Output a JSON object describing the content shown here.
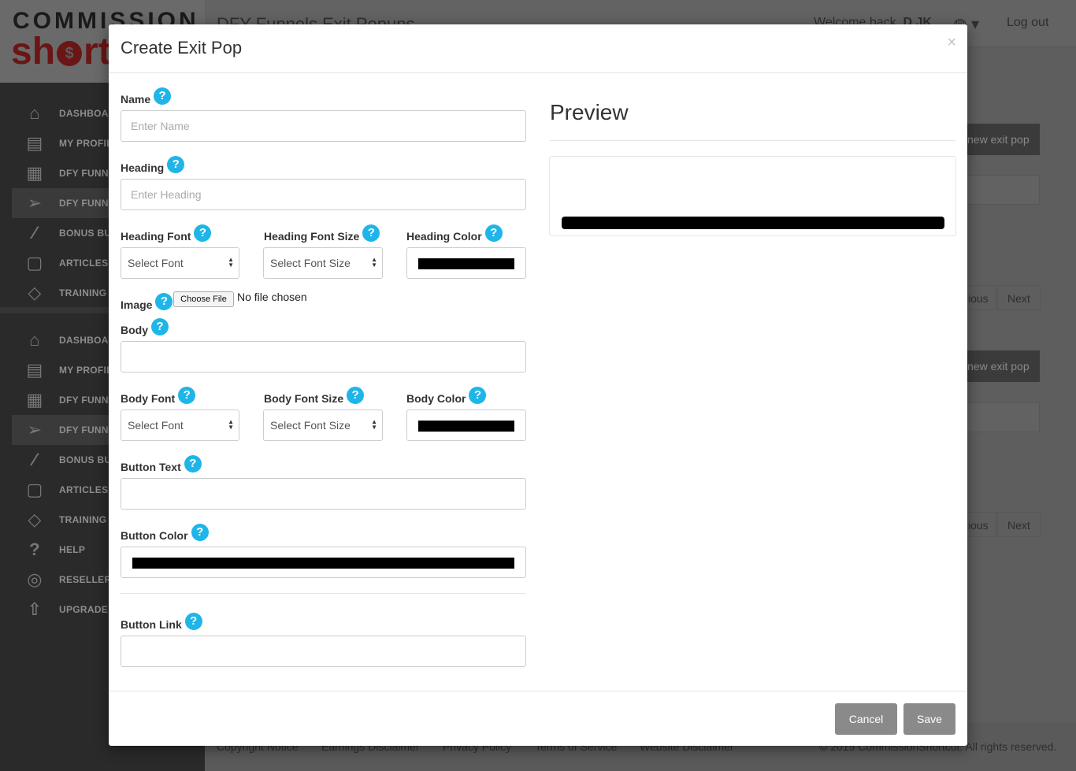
{
  "app": {
    "logo_top": "COMMISSION",
    "logo_bottom_left": "sh",
    "logo_coin": "$",
    "logo_bottom_right": "rt",
    "page_title": "DFY Funnels Exit Popups",
    "welcome_prefix": "Welcome back,",
    "welcome_user": "D JK",
    "logout": "Log out",
    "new_exit_pop_1": "new exit pop",
    "new_exit_pop_2": "new exit pop",
    "previous_1": "ious",
    "next_1": "Next",
    "previous_2": "ious",
    "next_2": "Next"
  },
  "sidebar": {
    "group1": [
      {
        "label": "DASHBOAR",
        "icon": "home-icon"
      },
      {
        "label": "MY PROFILI",
        "icon": "profile-icon"
      },
      {
        "label": "DFY FUNNE",
        "icon": "gift-icon"
      },
      {
        "label": "DFY FUNNE",
        "icon": "send-icon"
      },
      {
        "label": "BONUS BUI",
        "icon": "magic-wand-icon"
      },
      {
        "label": "ARTICLES",
        "icon": "clipboard-icon"
      },
      {
        "label": "TRAINING",
        "icon": "graduation-cap-icon"
      }
    ],
    "group2": [
      {
        "label": "DASHBOAR",
        "icon": "home-icon"
      },
      {
        "label": "MY PROFILI",
        "icon": "profile-icon"
      },
      {
        "label": "DFY FUNNE",
        "icon": "gift-icon"
      },
      {
        "label": "DFY FUNNE",
        "icon": "send-icon"
      },
      {
        "label": "BONUS BUI",
        "icon": "magic-wand-icon"
      },
      {
        "label": "ARTICLES",
        "icon": "clipboard-icon"
      },
      {
        "label": "TRAINING",
        "icon": "graduation-cap-icon"
      },
      {
        "label": "HELP",
        "icon": "help-icon"
      },
      {
        "label": "RESELLER I",
        "icon": "piggy-bank-icon"
      },
      {
        "label": "UPGRADE M",
        "icon": "rocket-icon"
      }
    ]
  },
  "footer": {
    "copyright_notice": "Copyright Notice",
    "earnings": "Earnings Disclaimer",
    "privacy": "Privacy Policy",
    "terms": "Terms of Service",
    "website": "Website Disclaimer",
    "rights": "© 2019 CommissionShortcut. All rights reserved."
  },
  "modal": {
    "title": "Create Exit Pop",
    "close": "×",
    "help_glyph": "?",
    "name_label": "Name",
    "name_placeholder": "Enter Name",
    "heading_label": "Heading",
    "heading_placeholder": "Enter Heading",
    "heading_font_label": "Heading Font",
    "heading_font_value": "Select Font",
    "heading_font_size_label": "Heading Font Size",
    "heading_font_size_value": "Select Font Size",
    "heading_color_label": "Heading Color",
    "heading_color_value": "#000000",
    "image_label": "Image",
    "choose_file": "Choose File",
    "no_file": "No file chosen",
    "body_label": "Body",
    "body_font_label": "Body Font",
    "body_font_value": "Select Font",
    "body_font_size_label": "Body Font Size",
    "body_font_size_value": "Select Font Size",
    "body_color_label": "Body Color",
    "body_color_value": "#000000",
    "button_text_label": "Button Text",
    "button_color_label": "Button Color",
    "button_color_value": "#000000",
    "button_link_label": "Button Link",
    "preview_title": "Preview",
    "cancel": "Cancel",
    "save": "Save"
  },
  "colors": {
    "help_badge": "#1fb5e8",
    "footer_button": "#8a8a8a",
    "overlay": "#555555"
  }
}
